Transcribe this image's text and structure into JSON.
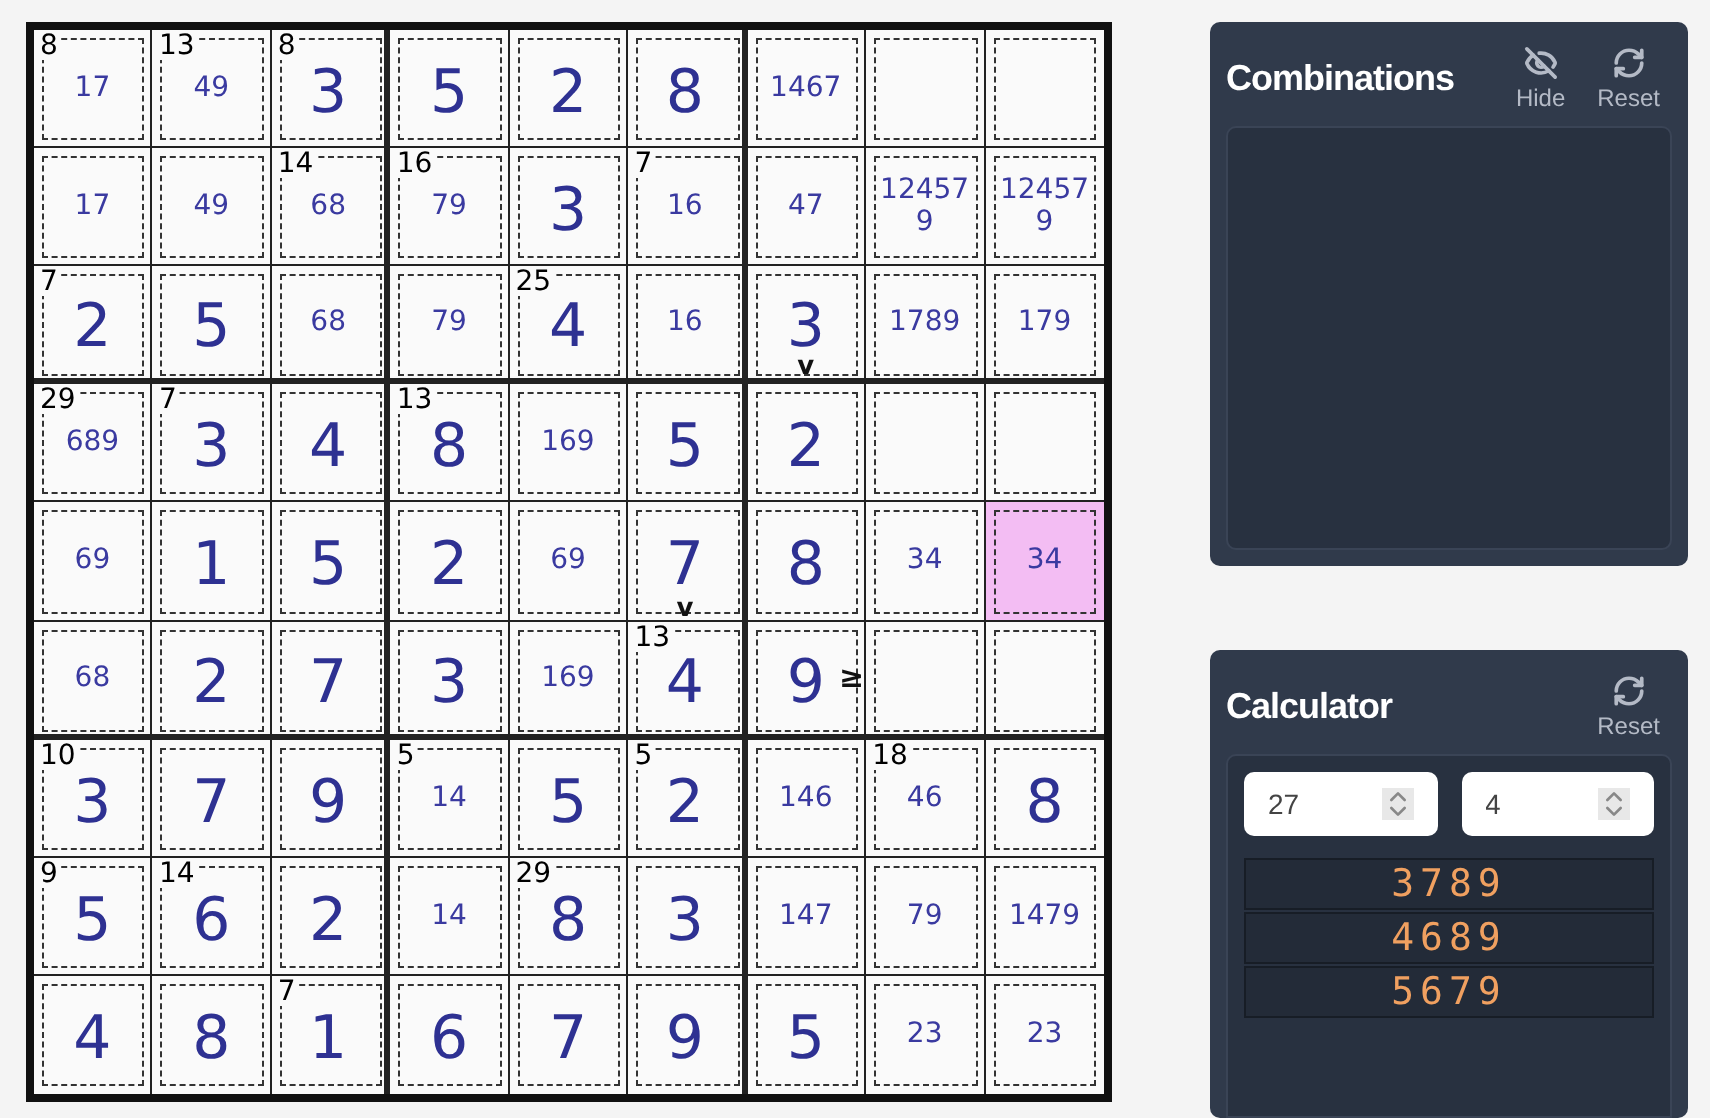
{
  "grid": {
    "rows": [
      [
        {
          "cage": "8",
          "candidates": "17",
          "selected": false
        },
        {
          "cage": "13",
          "candidates": "49",
          "selected": false
        },
        {
          "cage": "8",
          "value": "3",
          "selected": false
        },
        {
          "value": "5",
          "selected": false
        },
        {
          "value": "2",
          "selected": false
        },
        {
          "value": "8",
          "selected": false
        },
        {
          "candidates": "1467",
          "selected": false
        },
        {
          "selected": false
        },
        {
          "selected": false
        }
      ],
      [
        {
          "candidates": "17",
          "selected": false
        },
        {
          "candidates": "49",
          "selected": false
        },
        {
          "cage": "14",
          "candidates": "68",
          "selected": false
        },
        {
          "cage": "16",
          "candidates": "79",
          "selected": false
        },
        {
          "value": "3",
          "selected": false
        },
        {
          "cage": "7",
          "candidates": "16",
          "selected": false
        },
        {
          "candidates": "47",
          "selected": false
        },
        {
          "candidates": "124579",
          "selected": false
        },
        {
          "candidates": "124579",
          "selected": false
        }
      ],
      [
        {
          "cage": "7",
          "value": "2",
          "selected": false
        },
        {
          "value": "5",
          "selected": false
        },
        {
          "candidates": "68",
          "selected": false
        },
        {
          "candidates": "79",
          "selected": false
        },
        {
          "cage": "25",
          "value": "4",
          "selected": false
        },
        {
          "candidates": "16",
          "selected": false
        },
        {
          "value": "3",
          "sign": {
            "kind": "below",
            "text": "v"
          },
          "selected": false
        },
        {
          "candidates": "1789",
          "selected": false
        },
        {
          "candidates": "179",
          "selected": false
        }
      ],
      [
        {
          "cage": "29",
          "candidates": "689",
          "selected": false
        },
        {
          "cage": "7",
          "value": "3",
          "selected": false
        },
        {
          "value": "4",
          "selected": false
        },
        {
          "cage": "13",
          "value": "8",
          "selected": false
        },
        {
          "candidates": "169",
          "selected": false
        },
        {
          "value": "5",
          "selected": false
        },
        {
          "value": "2",
          "selected": false
        },
        {
          "selected": false
        },
        {
          "selected": false
        }
      ],
      [
        {
          "candidates": "69",
          "selected": false
        },
        {
          "value": "1",
          "selected": false
        },
        {
          "value": "5",
          "selected": false
        },
        {
          "value": "2",
          "selected": false
        },
        {
          "candidates": "69",
          "selected": false
        },
        {
          "value": "7",
          "sign": {
            "kind": "below",
            "text": "v"
          },
          "selected": false
        },
        {
          "value": "8",
          "selected": false
        },
        {
          "candidates": "34",
          "selected": false
        },
        {
          "candidates": "34",
          "selected": true
        }
      ],
      [
        {
          "candidates": "68",
          "selected": false
        },
        {
          "value": "2",
          "selected": false
        },
        {
          "value": "7",
          "selected": false
        },
        {
          "value": "3",
          "selected": false
        },
        {
          "candidates": "169",
          "selected": false
        },
        {
          "cage": "13",
          "value": "4",
          "selected": false
        },
        {
          "value": "9",
          "sign": {
            "kind": "right",
            "text": "≥"
          },
          "selected": false
        },
        {
          "selected": false
        },
        {
          "selected": false
        }
      ],
      [
        {
          "cage": "10",
          "value": "3",
          "selected": false
        },
        {
          "value": "7",
          "selected": false
        },
        {
          "value": "9",
          "selected": false
        },
        {
          "cage": "5",
          "candidates": "14",
          "selected": false
        },
        {
          "value": "5",
          "selected": false
        },
        {
          "cage": "5",
          "value": "2",
          "selected": false
        },
        {
          "candidates": "146",
          "selected": false
        },
        {
          "cage": "18",
          "candidates": "46",
          "selected": false
        },
        {
          "value": "8",
          "selected": false
        }
      ],
      [
        {
          "cage": "9",
          "value": "5",
          "selected": false
        },
        {
          "cage": "14",
          "value": "6",
          "selected": false
        },
        {
          "value": "2",
          "selected": false
        },
        {
          "candidates": "14",
          "selected": false
        },
        {
          "cage": "29",
          "value": "8",
          "selected": false
        },
        {
          "value": "3",
          "selected": false
        },
        {
          "candidates": "147",
          "selected": false
        },
        {
          "candidates": "79",
          "selected": false
        },
        {
          "candidates": "1479",
          "selected": false
        }
      ],
      [
        {
          "value": "4",
          "selected": false
        },
        {
          "value": "8",
          "selected": false
        },
        {
          "cage": "7",
          "value": "1",
          "selected": false
        },
        {
          "value": "6",
          "selected": false
        },
        {
          "value": "7",
          "selected": false
        },
        {
          "value": "9",
          "selected": false
        },
        {
          "value": "5",
          "selected": false
        },
        {
          "candidates": "23",
          "selected": false
        },
        {
          "candidates": "23",
          "selected": false
        }
      ]
    ]
  },
  "combinations": {
    "title": "Combinations",
    "buttons": [
      {
        "kind": "hide",
        "label": "Hide"
      },
      {
        "kind": "reset",
        "label": "Reset"
      }
    ]
  },
  "calculator": {
    "title": "Calculator",
    "buttons": [
      {
        "kind": "reset",
        "label": "Reset"
      }
    ],
    "inputs": [
      {
        "value": "27"
      },
      {
        "value": "4"
      }
    ],
    "results": [
      "3789",
      "4689",
      "5679"
    ]
  }
}
